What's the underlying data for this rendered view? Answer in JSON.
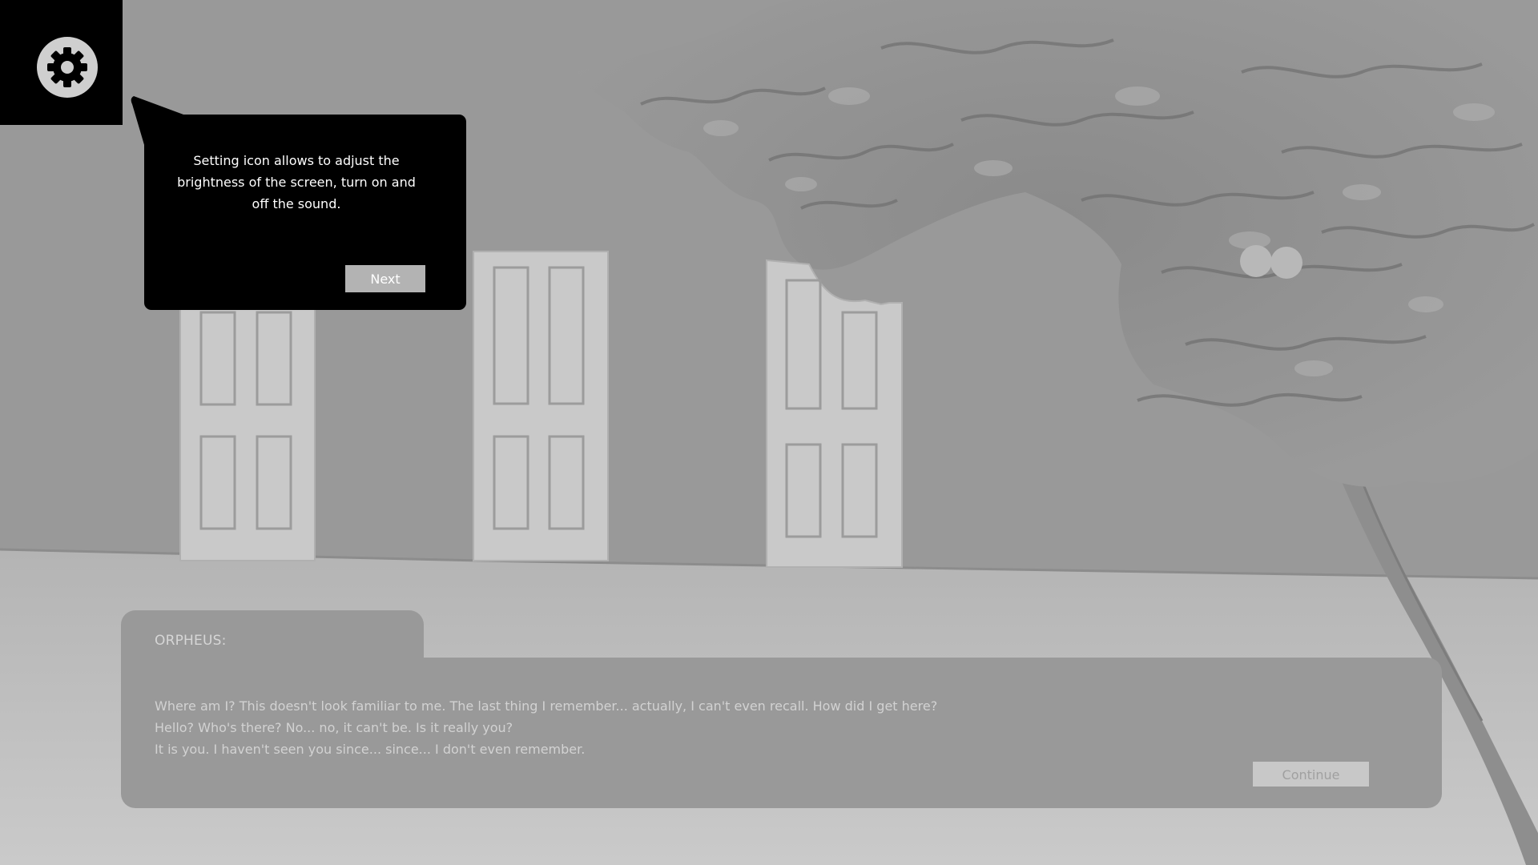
{
  "settings": {
    "icon": "gear-icon"
  },
  "tooltip": {
    "text": "Setting icon allows to adjust the brightness of the screen, turn on and off the sound.",
    "next_label": "Next"
  },
  "dialog": {
    "speaker": "ORPHEUS:",
    "lines": [
      "Where am I? This doesn't look familiar to me. The last thing I remember... actually, I can't even recall. How did I get here?",
      "Hello? Who's there? No... no, it can't be. Is it really you?",
      "It is you. I haven't seen you since... since... I don't even remember."
    ],
    "continue_label": "Continue"
  },
  "scene": {
    "objects": [
      "door",
      "door",
      "door",
      "tree"
    ]
  },
  "colors": {
    "wall": "#999999",
    "floor": "#bdbdbd",
    "panel": "#000000",
    "button": "#b3b3b3"
  }
}
